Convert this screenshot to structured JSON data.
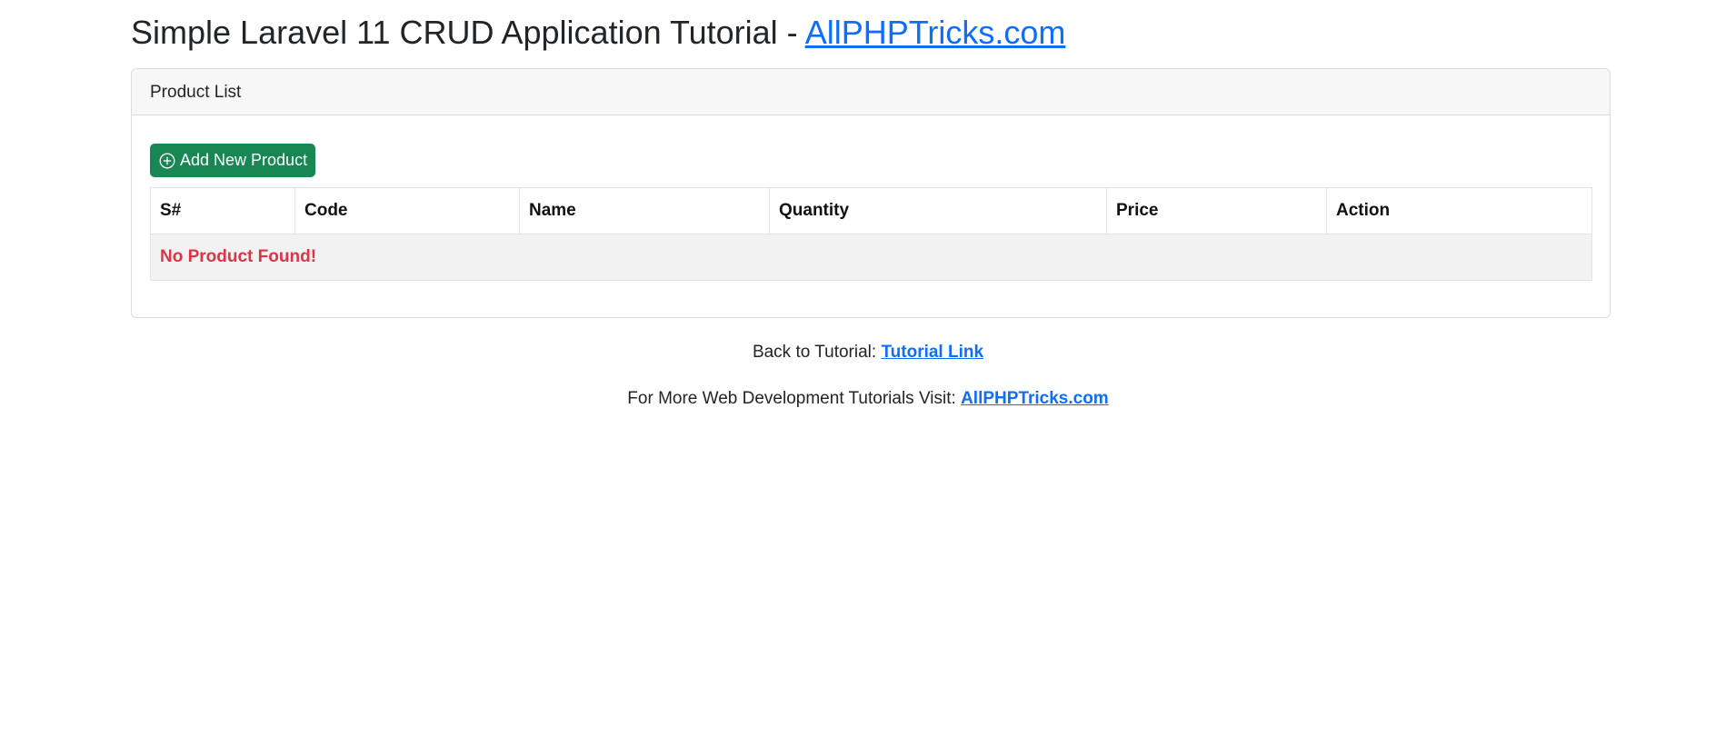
{
  "header": {
    "title_prefix": "Simple Laravel 11 CRUD Application Tutorial - ",
    "title_link": "AllPHPTricks.com"
  },
  "card": {
    "header_label": "Product List",
    "add_button_label": "Add New Product",
    "add_button_icon": "plus-circle-icon",
    "table": {
      "columns": [
        "S#",
        "Code",
        "Name",
        "Quantity",
        "Price",
        "Action"
      ],
      "empty_message": "No Product Found!"
    }
  },
  "footer": {
    "back_prefix": "Back to Tutorial: ",
    "back_link": "Tutorial Link",
    "more_prefix": "For More Web Development Tutorials Visit: ",
    "more_link": "AllPHPTricks.com"
  },
  "colors": {
    "link": "#0d6efd",
    "button_success": "#198754",
    "error_text": "#dc3545"
  }
}
